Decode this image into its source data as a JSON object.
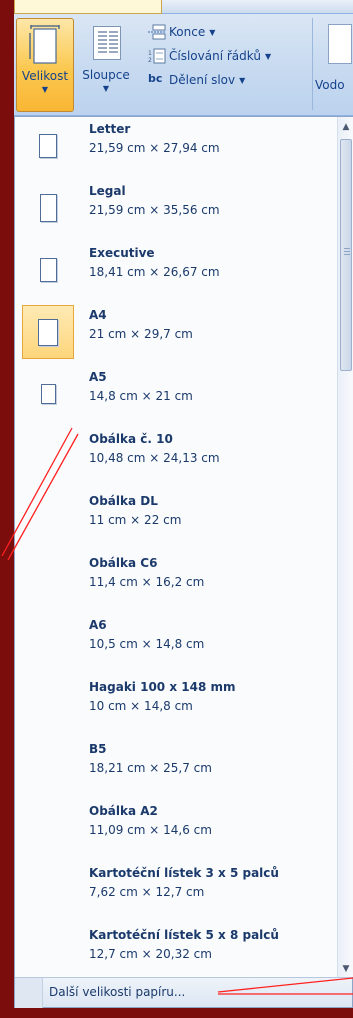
{
  "ribbon": {
    "size_button": {
      "label": "Velikost"
    },
    "columns_button": {
      "label": "Sloupce"
    },
    "breaks_button": {
      "label": "Konce"
    },
    "line_numbers_button": {
      "label": "Číslování řádků"
    },
    "hyphenation_button": {
      "label": "Dělení slov",
      "icon_text": "bc"
    },
    "watermark_button": {
      "label": "Vodo"
    }
  },
  "menu": {
    "items": [
      {
        "name": "Letter",
        "dims": "21,59 cm × 27,94 cm"
      },
      {
        "name": "Legal",
        "dims": "21,59 cm × 35,56 cm"
      },
      {
        "name": "Executive",
        "dims": "18,41 cm × 26,67 cm"
      },
      {
        "name": "A4",
        "dims": "21 cm × 29,7 cm",
        "selected": true
      },
      {
        "name": "A5",
        "dims": "14,8 cm × 21 cm"
      },
      {
        "name": "Obálka č. 10",
        "dims": "10,48 cm × 24,13 cm"
      },
      {
        "name": "Obálka DL",
        "dims": "11 cm × 22 cm"
      },
      {
        "name": "Obálka C6",
        "dims": "11,4 cm × 16,2 cm"
      },
      {
        "name": "A6",
        "dims": "10,5 cm × 14,8 cm"
      },
      {
        "name": "Hagaki 100 x 148 mm",
        "dims": "10 cm × 14,8 cm"
      },
      {
        "name": "B5",
        "dims": "18,21 cm × 25,7 cm"
      },
      {
        "name": "Obálka A2",
        "dims": "11,09 cm × 14,6 cm"
      },
      {
        "name": "Kartotéční lístek 3 x 5 palců",
        "dims": "7,62 cm × 12,7 cm"
      },
      {
        "name": "Kartotéční lístek 5 x 8 palců",
        "dims": "12,7 cm × 20,32 cm"
      }
    ],
    "more_sizes_label": "Další velikosti papíru..."
  },
  "colors": {
    "accent": "#fbc84f",
    "slide_background": "#7b0d0d",
    "callout_line": "#ff0000"
  }
}
